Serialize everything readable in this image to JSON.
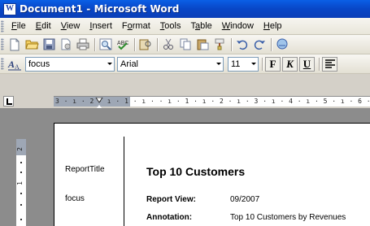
{
  "window": {
    "title": "Document1 - Microsoft Word",
    "icon": "word-doc-icon"
  },
  "menubar": {
    "items": [
      {
        "mnemonic": "F",
        "rest": "ile"
      },
      {
        "mnemonic": "E",
        "rest": "dit"
      },
      {
        "mnemonic": "V",
        "rest": "iew"
      },
      {
        "mnemonic": "I",
        "rest": "nsert"
      },
      {
        "pre": "F",
        "mnemonic": "o",
        "rest": "rmat"
      },
      {
        "mnemonic": "T",
        "rest": "ools"
      },
      {
        "pre": "T",
        "mnemonic": "a",
        "rest": "ble"
      },
      {
        "mnemonic": "W",
        "rest": "indow"
      },
      {
        "mnemonic": "H",
        "rest": "elp"
      }
    ]
  },
  "standard_toolbar": {
    "icons": [
      "new-icon",
      "open-icon",
      "save-icon",
      "permission-icon",
      "print-icon",
      "print-preview-icon",
      "spelling-icon",
      "research-icon",
      "cut-icon",
      "copy-icon",
      "paste-icon",
      "format-painter-icon",
      "undo-icon",
      "redo-icon",
      "hyperlink-icon"
    ]
  },
  "formatting_toolbar": {
    "style_value": "focus",
    "font_value": "Arial",
    "size_value": "11",
    "bold_label": "F",
    "italic_label": "K",
    "underline_label": "U"
  },
  "ruler": {
    "horizontal_numbers": "3 · ı · 2 · ı · 1 · ı ·   · ı · 1 · ı · 2 · ı · 3 · ı · 4 · ı · 5 · ı · 6 · ı",
    "vertical_numbers": [
      "2",
      "1"
    ]
  },
  "document": {
    "left_labels": {
      "report_title": "ReportTitle",
      "focus": "focus"
    },
    "heading": "Top 10 Customers",
    "fields": [
      {
        "label": "Report View:",
        "value": "09/2007"
      },
      {
        "label": "Annotation:",
        "value": "Top 10 Customers by Revenues"
      }
    ]
  },
  "colors": {
    "title_bar": "#0846c6",
    "toolbar_bg": "#ece9d8",
    "workspace": "#8c8c8c"
  }
}
